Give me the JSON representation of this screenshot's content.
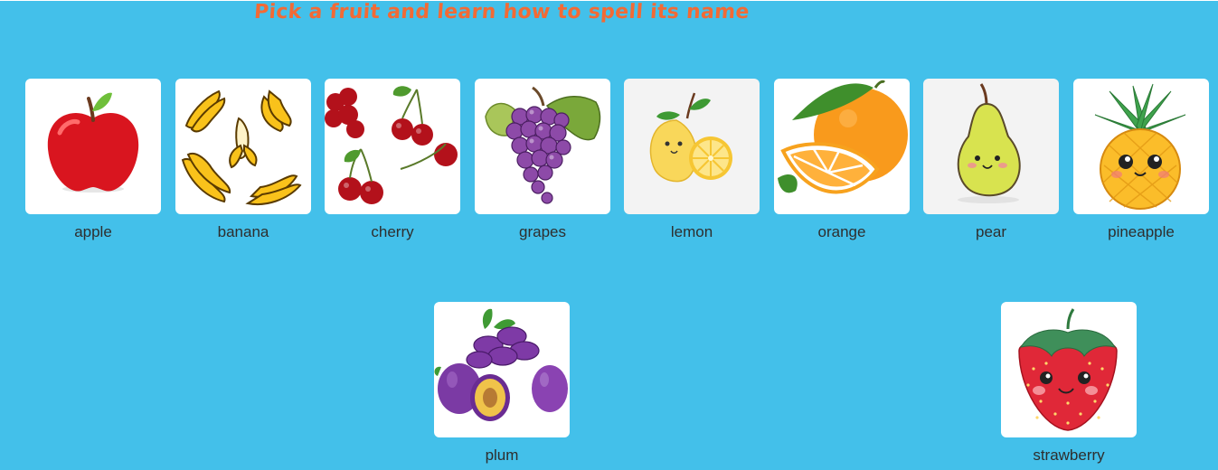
{
  "page": {
    "title": "Pick a fruit and learn how to spell its name"
  },
  "fruits": [
    {
      "name": "apple",
      "icon": "apple-icon"
    },
    {
      "name": "banana",
      "icon": "banana-icon"
    },
    {
      "name": "cherry",
      "icon": "cherry-icon"
    },
    {
      "name": "grapes",
      "icon": "grapes-icon"
    },
    {
      "name": "lemon",
      "icon": "lemon-icon"
    },
    {
      "name": "orange",
      "icon": "orange-icon"
    },
    {
      "name": "pear",
      "icon": "pear-icon"
    },
    {
      "name": "pineapple",
      "icon": "pineapple-icon"
    },
    {
      "name": "plum",
      "icon": "plum-icon"
    },
    {
      "name": "strawberry",
      "icon": "strawberry-icon"
    }
  ],
  "colors": {
    "background": "#43c0ea",
    "title": "#f26a35",
    "tile": "#ffffff",
    "label": "#2e2e2e"
  }
}
